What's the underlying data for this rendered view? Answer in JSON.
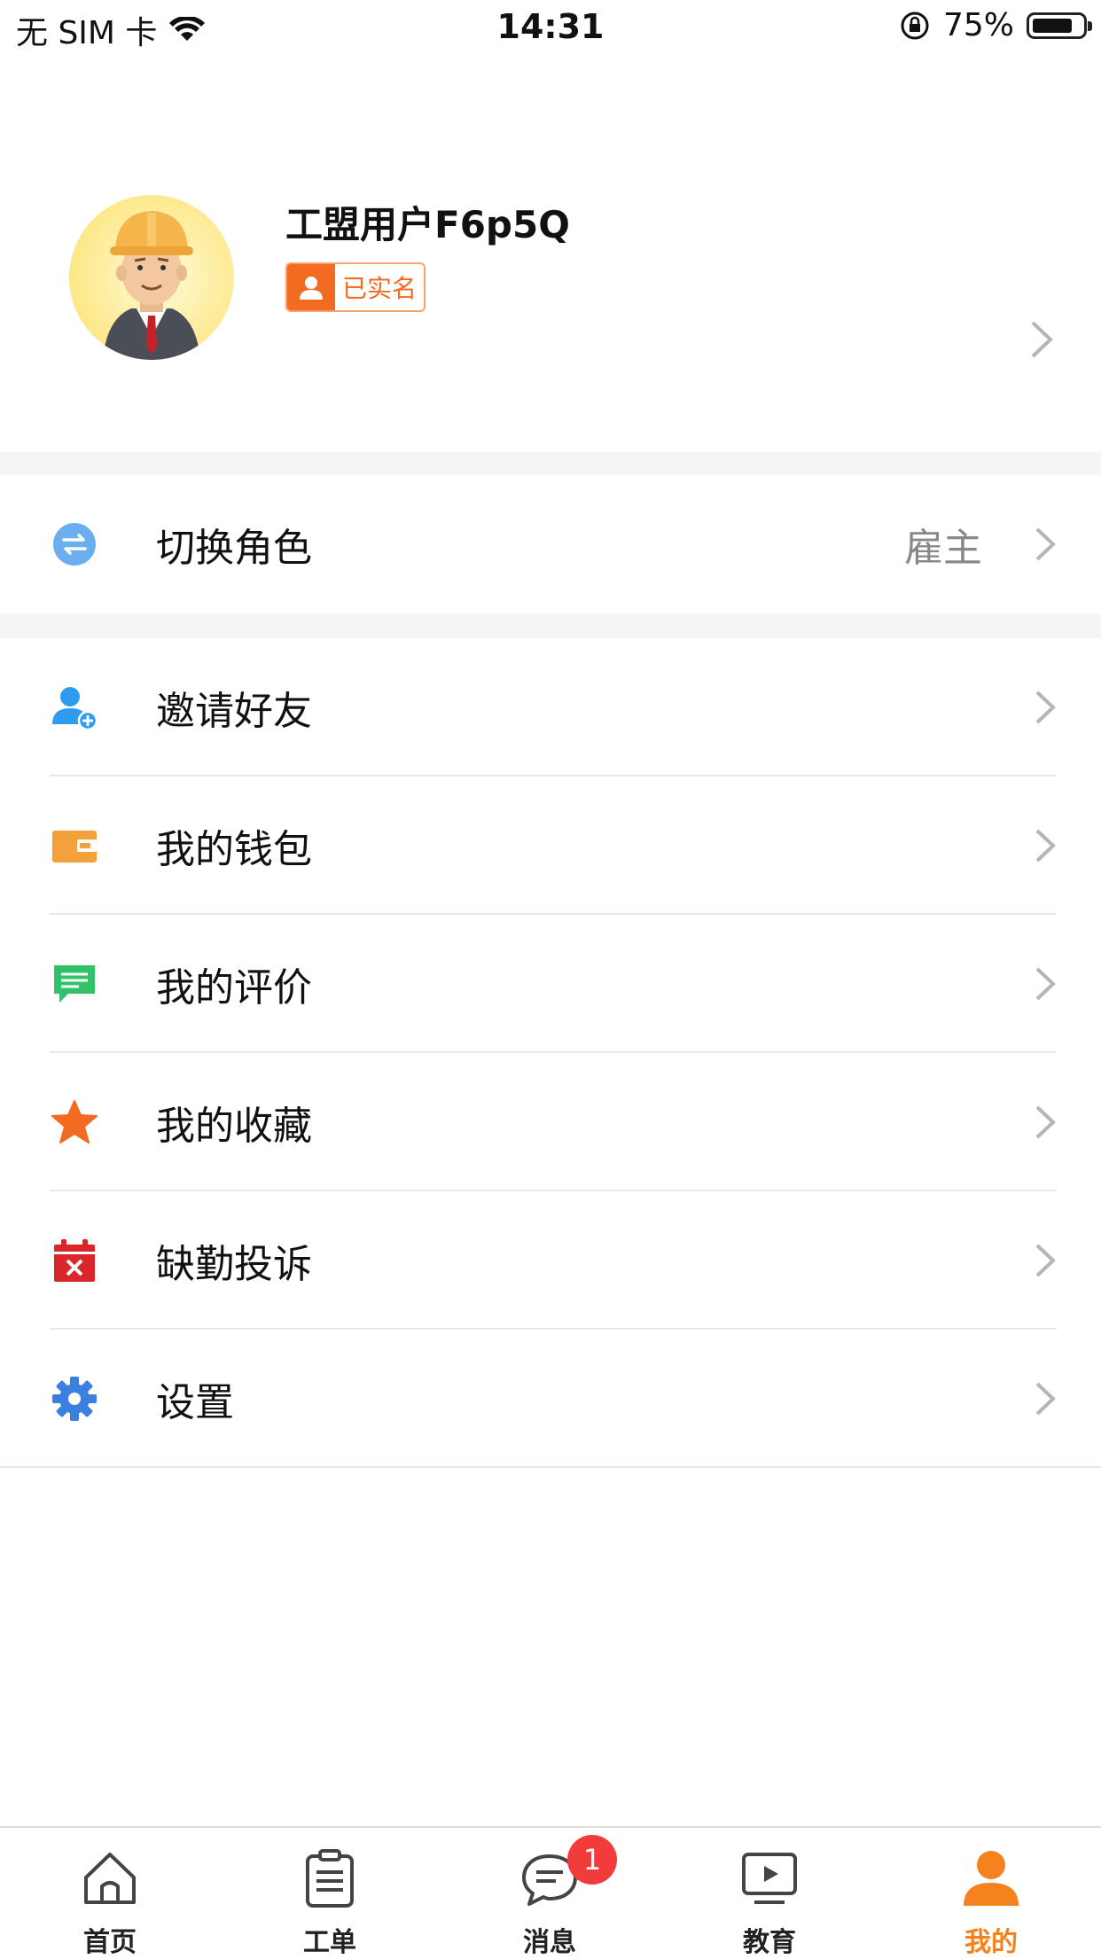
{
  "status_bar": {
    "carrier": "无 SIM 卡",
    "time": "14:31",
    "battery": "75%"
  },
  "profile": {
    "name": "工盟用户F6p5Q",
    "verified_label": "已实名"
  },
  "role": {
    "label": "切换角色",
    "value": "雇主"
  },
  "menu": [
    {
      "label": "邀请好友",
      "icon": "add-user-icon"
    },
    {
      "label": "我的钱包",
      "icon": "wallet-icon"
    },
    {
      "label": "我的评价",
      "icon": "comment-icon"
    },
    {
      "label": "我的收藏",
      "icon": "star-icon"
    },
    {
      "label": "缺勤投诉",
      "icon": "calendar-x-icon"
    },
    {
      "label": "设置",
      "icon": "gear-icon"
    }
  ],
  "tabs": [
    {
      "label": "首页",
      "icon": "home-icon"
    },
    {
      "label": "工单",
      "icon": "clipboard-icon"
    },
    {
      "label": "消息",
      "icon": "chat-icon",
      "badge": "1"
    },
    {
      "label": "教育",
      "icon": "video-icon"
    },
    {
      "label": "我的",
      "icon": "person-icon",
      "active": true
    }
  ],
  "colors": {
    "accent": "#f5821f",
    "badge": "#f23c3c",
    "verified": "#f36b21"
  }
}
